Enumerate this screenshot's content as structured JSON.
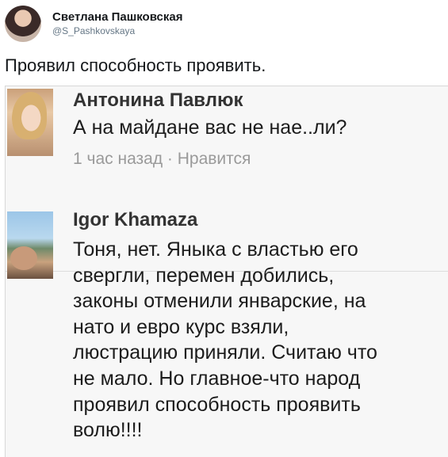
{
  "tweet": {
    "author_name": "Светлана Пашковская",
    "author_handle": "@S_Pashkovskaya",
    "text": "Проявил способность проявить."
  },
  "comments": [
    {
      "author": "Антонина Павлюк",
      "text": "А на майдане вас не нае..ли?",
      "meta": "1 час назад · Нравится"
    },
    {
      "author": "Igor Khamaza",
      "text": "Тоня, нет. Яныка с властью его\nсвергли, перемен добились,\nзаконы отменили январские, на\nнато и евро курс взяли,\nлюстрацию приняли. Считаю что\nне мало. Но главное-что народ\nпроявил способность проявить\nволю!!!!"
    }
  ]
}
